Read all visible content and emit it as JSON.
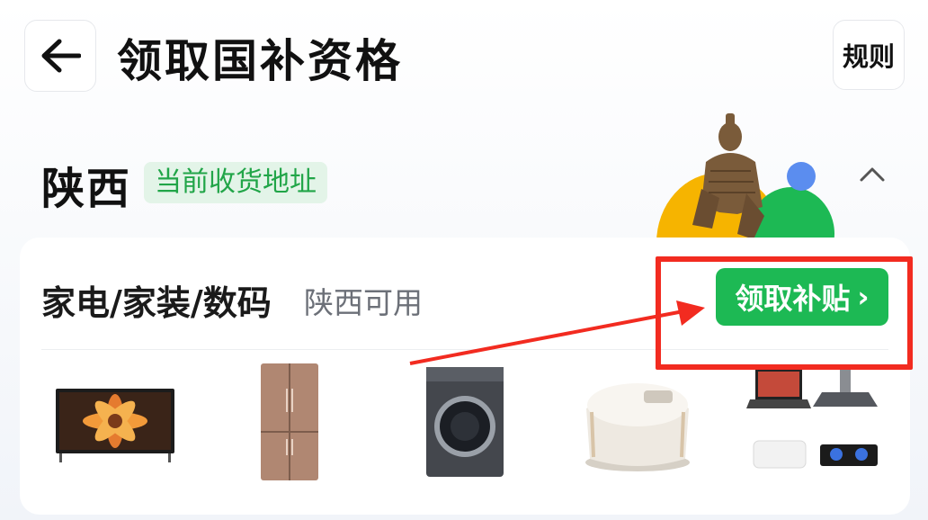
{
  "header": {
    "title": "领取国补资格",
    "rules_label": "规则"
  },
  "region": {
    "province": "陕西",
    "address_badge": "当前收货地址"
  },
  "category": {
    "title": "家电/家装/数码",
    "availability": "陕西可用",
    "claim_label": "领取补贴",
    "claim_arrow": "›",
    "products": [
      "television",
      "refrigerator",
      "washing-machine",
      "rice-cooker",
      "laptop-range-hood-ac-stove"
    ]
  },
  "colors": {
    "accent_green": "#1db954",
    "badge_bg": "#e3f4e8",
    "annotation_red": "#f22b20"
  }
}
